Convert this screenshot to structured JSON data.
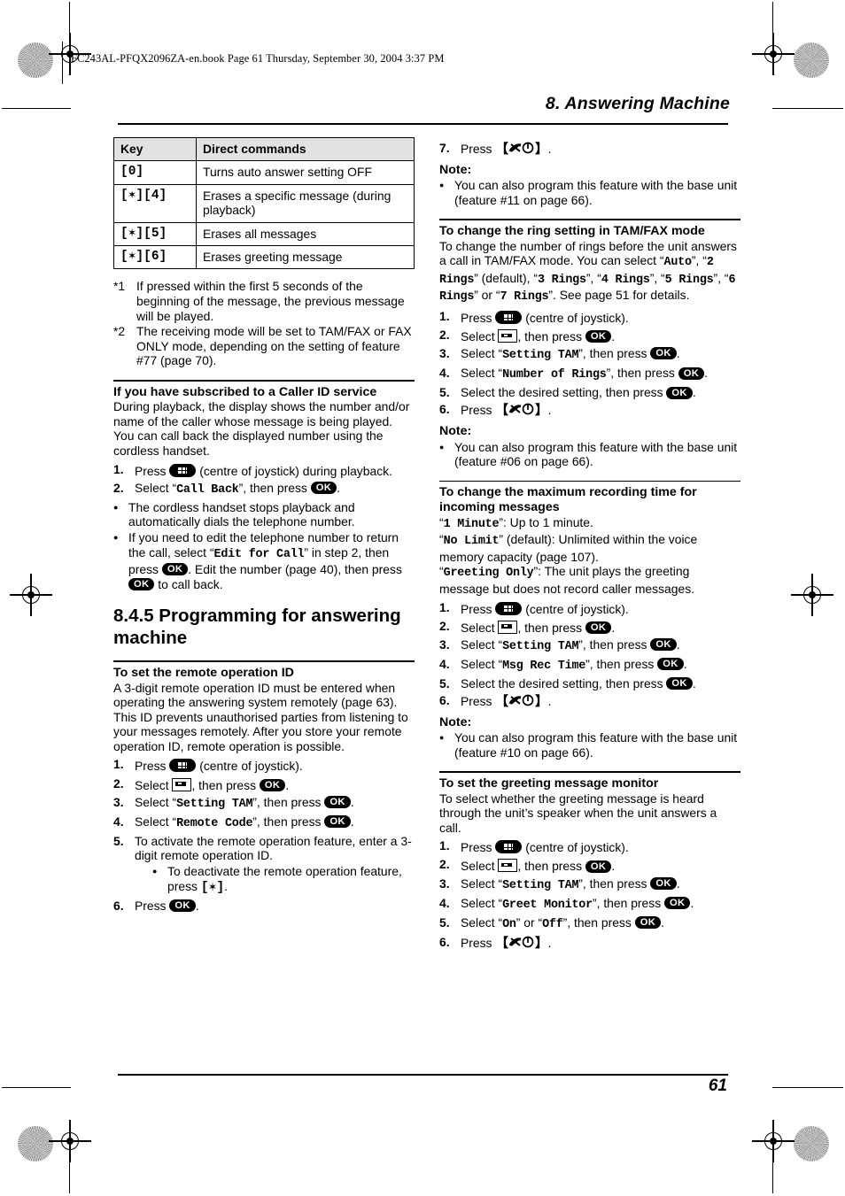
{
  "page": {
    "book_info": "FC243AL-PFQX2096ZA-en.book  Page 61  Thursday, September 30, 2004  3:37 PM",
    "chapter_title": "8. Answering Machine",
    "page_number": "61"
  },
  "table": {
    "headers": [
      "Key",
      "Direct commands"
    ],
    "rows": [
      {
        "key": "[0]",
        "command": "Turns auto answer setting OFF"
      },
      {
        "key": "[✶][4]",
        "command": "Erases a specific message (during playback)"
      },
      {
        "key": "[✶][5]",
        "command": "Erases all messages"
      },
      {
        "key": "[✶][6]",
        "command": "Erases greeting message"
      }
    ]
  },
  "footnotes": [
    {
      "marker": "*1",
      "text": "If pressed within the first 5 seconds of the beginning of the message, the previous message will be played."
    },
    {
      "marker": "*2",
      "text": "The receiving mode will be set to TAM/FAX or FAX ONLY mode, depending on the setting of feature #77 (page 70)."
    }
  ],
  "caller_id": {
    "heading": "If you have subscribed to a Caller ID service",
    "body1": "During playback, the display shows the number and/or name of the caller whose message is being played.",
    "body2": "You can call back the displayed number using the cordless handset.",
    "step1_pre": "Press",
    "step1_post": "(centre of joystick) during playback.",
    "step2_pre": "Select “",
    "step2_value": "Call Back",
    "step2_mid": "”, then press",
    "step2_ok": "OK",
    "step2_post": ".",
    "bullet1": "The cordless handset stops playback and automatically dials the telephone number.",
    "bullet2_a": "If you need to edit the telephone number to return the call, select “",
    "bullet2_value": "Edit for Call",
    "bullet2_b": "” in step 2, then press",
    "bullet2_ok1": "OK",
    "bullet2_c": ". Edit the number (page 40), then press",
    "bullet2_ok2": "OK",
    "bullet2_d": "to call back."
  },
  "section_845": {
    "title": "8.4.5 Programming for answering machine"
  },
  "remote_id": {
    "heading": "To set the remote operation ID",
    "body": "A 3-digit remote operation ID must be entered when operating the answering system remotely (page 63). This ID prevents unauthorised parties from listening to your messages remotely. After you store your remote operation ID, remote operation is possible.",
    "steps": [
      {
        "n": "1.",
        "pre": "Press",
        "icon": "joystick",
        "post": "(centre of joystick)."
      },
      {
        "n": "2.",
        "pre": "Select",
        "icon": "tape",
        "mid": ", then press",
        "ok": "OK",
        "post": "."
      },
      {
        "n": "3.",
        "pre": "Select “",
        "value": "Setting TAM",
        "mid": "”, then press",
        "ok": "OK",
        "post": "."
      },
      {
        "n": "4.",
        "pre": "Select “",
        "value": "Remote Code",
        "mid": "”, then press",
        "ok": "OK",
        "post": "."
      },
      {
        "n": "5.",
        "pre": "To activate the remote operation feature, enter a 3-digit remote operation ID."
      },
      {
        "n": "6.",
        "pre": "Press",
        "ok": "OK",
        "post": "."
      }
    ],
    "step5_bullet_a": "To deactivate the remote operation feature, press",
    "step5_bullet_key": "[✶]",
    "step5_bullet_b": "."
  },
  "right_top": {
    "step7_n": "7.",
    "step7_pre": "Press",
    "step7_key": "【 】",
    "step7_post": ".",
    "note_label": "Note:",
    "note_bullet": "You can also program this feature with the base unit (feature #11 on page 66)."
  },
  "ring_setting": {
    "heading": "To change the ring setting in TAM/FAX mode",
    "body_a": "To change the number of rings before the unit answers a call in TAM/FAX mode. You can select “",
    "v1": "Auto",
    "b1": "”, “",
    "v2": "2 Rings",
    "b2": "” (default), “",
    "v3": "3 Rings",
    "b3": "”, “",
    "v4": "4 Rings",
    "b4": "”, “",
    "v5": "5 Rings",
    "b5": "”, “",
    "v6": "6 Rings",
    "b6": "” or “",
    "v7": "7 Rings",
    "b7": "”. See page 51 for details.",
    "steps": [
      {
        "n": "1.",
        "pre": "Press",
        "icon": "joystick",
        "post": "(centre of joystick)."
      },
      {
        "n": "2.",
        "pre": "Select",
        "icon": "tape",
        "mid": ", then press",
        "ok": "OK",
        "post": "."
      },
      {
        "n": "3.",
        "pre": "Select “",
        "value": "Setting TAM",
        "mid": "”, then press",
        "ok": "OK",
        "post": "."
      },
      {
        "n": "4.",
        "pre": "Select “",
        "value": "Number of Rings",
        "mid": "”, then press",
        "ok": "OK",
        "post": "."
      },
      {
        "n": "5.",
        "pre": "Select the desired setting, then press",
        "ok": "OK",
        "post": "."
      },
      {
        "n": "6.",
        "pre": "Press",
        "icon": "poweroff",
        "post": "."
      }
    ],
    "note_label": "Note:",
    "note_bullet": "You can also program this feature with the base unit (feature #06 on page 66)."
  },
  "rec_time": {
    "heading": "To change the maximum recording time for incoming messages",
    "l1_q": "1 Minute",
    "l1_t": "”: Up to 1 minute.",
    "l2_q": "No Limit",
    "l2_t": "” (default): Unlimited within the voice memory capacity (page 107).",
    "l3_q": "Greeting Only",
    "l3_t": "”: The unit plays the greeting message but does not record caller messages.",
    "steps": [
      {
        "n": "1.",
        "pre": "Press",
        "icon": "joystick",
        "post": "(centre of joystick)."
      },
      {
        "n": "2.",
        "pre": "Select",
        "icon": "tape",
        "mid": ", then press",
        "ok": "OK",
        "post": "."
      },
      {
        "n": "3.",
        "pre": "Select “",
        "value": "Setting TAM",
        "mid": "”, then press",
        "ok": "OK",
        "post": "."
      },
      {
        "n": "4.",
        "pre": "Select “",
        "value": "Msg Rec Time",
        "mid": "”, then press",
        "ok": "OK",
        "post": "."
      },
      {
        "n": "5.",
        "pre": "Select the desired setting, then press",
        "ok": "OK",
        "post": "."
      },
      {
        "n": "6.",
        "pre": "Press",
        "icon": "poweroff",
        "post": "."
      }
    ],
    "note_label": "Note:",
    "note_bullet": "You can also program this feature with the base unit (feature #10 on page 66)."
  },
  "greet_monitor": {
    "heading": "To set the greeting message monitor",
    "body": "To select whether the greeting message is heard through the unit’s speaker when the unit answers a call.",
    "steps": [
      {
        "n": "1.",
        "pre": "Press",
        "icon": "joystick",
        "post": "(centre of joystick)."
      },
      {
        "n": "2.",
        "pre": "Select",
        "icon": "tape",
        "mid": ", then press",
        "ok": "OK",
        "post": "."
      },
      {
        "n": "3.",
        "pre": "Select “",
        "value": "Setting TAM",
        "mid": "”, then press",
        "ok": "OK",
        "post": "."
      },
      {
        "n": "4.",
        "pre": "Select “",
        "value": "Greet Monitor",
        "mid": "”, then press",
        "ok": "OK",
        "post": "."
      },
      {
        "n": "5.",
        "pre": "Select “",
        "value": "On",
        "mid2": "” or “",
        "value2": "Off",
        "mid": "”, then press",
        "ok": "OK",
        "post": "."
      },
      {
        "n": "6.",
        "pre": "Press",
        "icon": "poweroff",
        "post": "."
      }
    ]
  }
}
